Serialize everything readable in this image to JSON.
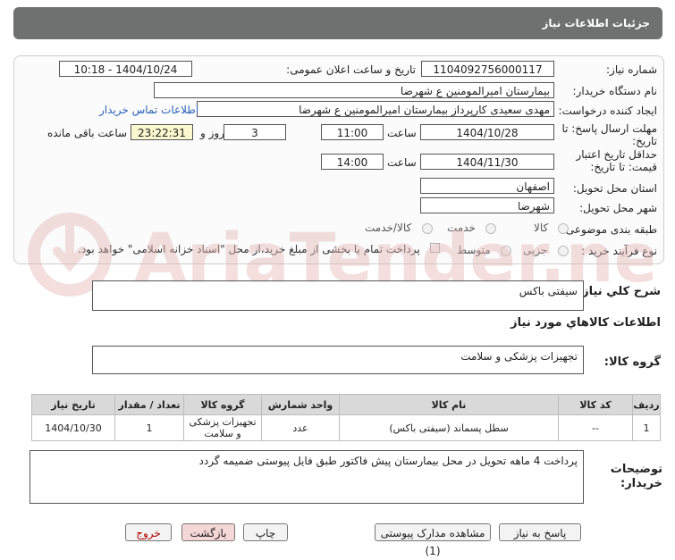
{
  "header": {
    "title": "جزئیات اطلاعات نیاز"
  },
  "form": {
    "need_number_label": "شماره نیاز:",
    "need_number": "1104092756000117",
    "announce_label": "تاریخ و ساعت اعلان عمومی:",
    "announce_value": "1404/10/24 - 10:18",
    "buyer_label": "نام دستگاه خریدار:",
    "buyer_value": "بیمارستان امیرالمومنین ع  شهرضا",
    "creator_label": "ایجاد کننده درخواست:",
    "creator_value": "مهدی سعیدی کارپرداز بیمارستان امیرالمومنین ع  شهرضا",
    "contact_link": "اطلاعات تماس خریدار",
    "deadline_label": "مهلت ارسال پاسخ: تا تاریخ:",
    "deadline_date": "1404/10/28",
    "time_label": "ساعت",
    "deadline_time": "11:00",
    "days_value": "3",
    "days_label": "روز و",
    "remaining_time": "23:22:31",
    "remaining_label": "ساعت باقی مانده",
    "validity_label": "حداقل تاریخ اعتبار قیمت: تا تاریخ:",
    "validity_date": "1404/11/30",
    "validity_time": "14:00",
    "province_label": "استان محل تحویل:",
    "province_value": "اصفهان",
    "city_label": "شهر محل تحویل:",
    "city_value": "شهرضا",
    "category_label": "طبقه بندی موضوعی:",
    "category_options": [
      "کالا",
      "خدمت",
      "کالا/خدمت"
    ],
    "purchase_label": "نوع فرآیند خرید :",
    "purchase_options": [
      "جزیی",
      "متوسط"
    ],
    "payment_note": "پرداخت تمام یا بخشی از مبلغ خرید،از محل \"اسناد خزانه اسلامی\" خواهد بود."
  },
  "summary": {
    "label": "شرح کلي نياز:",
    "value": "سیفتی باکس",
    "goods_info_label": "اطلاعات کالاهاي مورد نياز",
    "group_label": "گروه کالا:",
    "group_value": "تجهیزات پزشکی و سلامت"
  },
  "table": {
    "headers": [
      "ردیف",
      "کد کالا",
      "نام کالا",
      "واحد شمارش",
      "گروه کالا",
      "تعداد / مقدار",
      "تاریخ نیاز"
    ],
    "rows": [
      [
        "1",
        "--",
        "سطل پسماند (سیفتی باکس)",
        "عدد",
        "تجهیزات پزشکی و سلامت",
        "1",
        "1404/10/30"
      ]
    ]
  },
  "buyer_notes": {
    "label": "توضیحات خریدار:",
    "value": "پرداخت 4 ماهه تحویل در محل بیمارستان پیش فاکتور طبق فایل پیوستی ضمیمه گردد"
  },
  "buttons": {
    "reply": "پاسخ به نیاز",
    "attachments": "مشاهده مدارک پیوستی (1)",
    "print": "چاپ",
    "back": "بازگشت",
    "exit": "خروج"
  },
  "watermark": {
    "text": "AriaTender.neT"
  },
  "colors": {
    "header_bg": "#6f7070",
    "link": "#2a62b8",
    "remaining_bg": "#fbf7cf",
    "exit_button_text": "#b00000",
    "back_button_bg": "#f6d7d7",
    "watermark": "#e7b8b8"
  }
}
